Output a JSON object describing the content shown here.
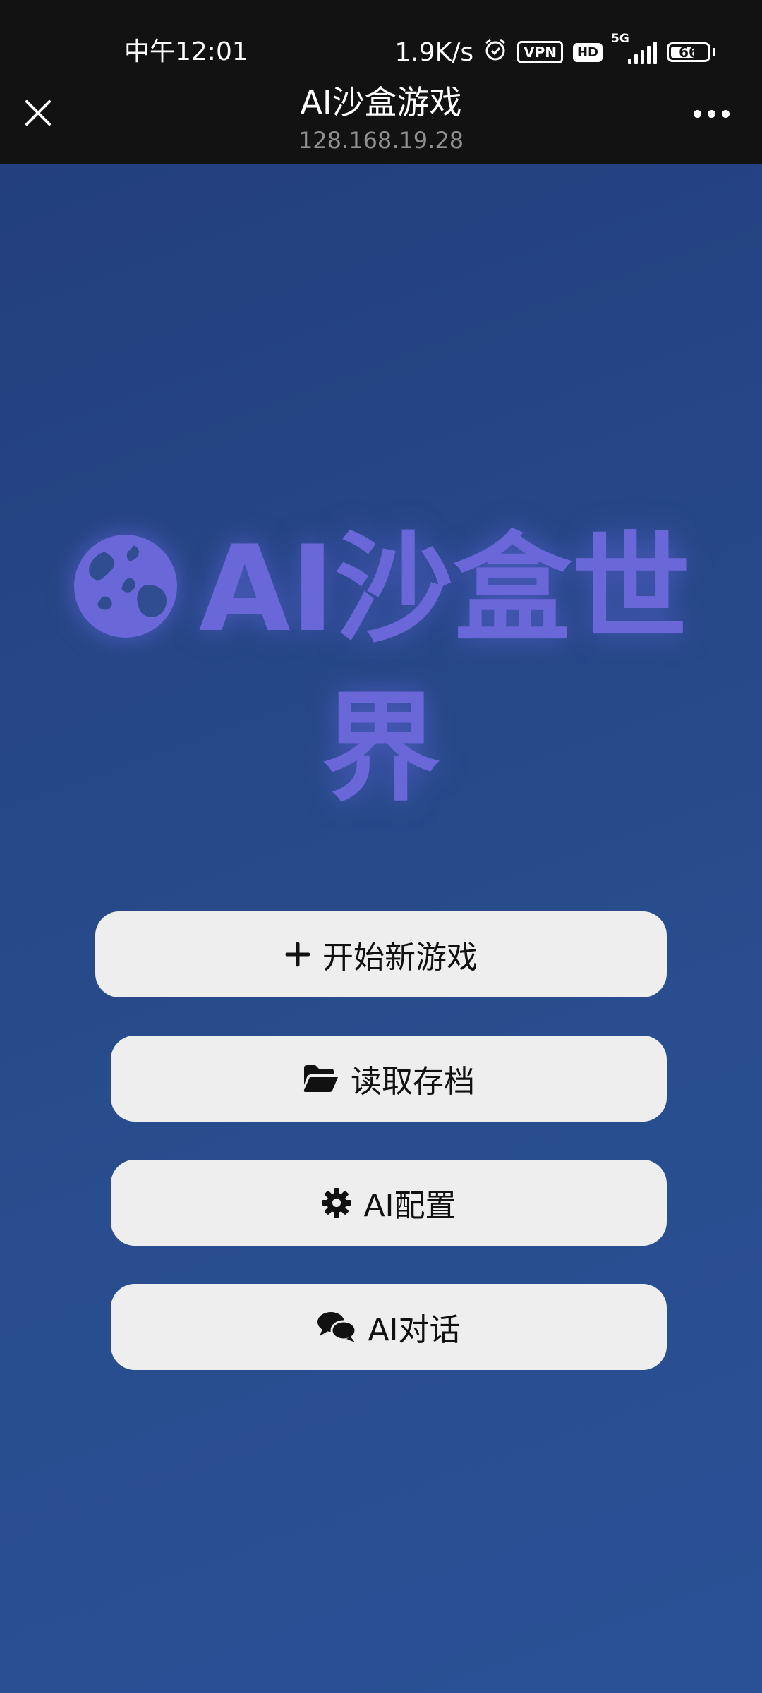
{
  "status_bar": {
    "time": "中午12:01",
    "net_speed": "1.9K/s",
    "vpn_badge": "VPN",
    "hd_badge": "HD",
    "network_type": "5G",
    "battery": "66",
    "battery_level": 0.66,
    "icons": [
      "alarm-icon",
      "vpn-icon",
      "hd-icon",
      "signal-icon",
      "battery-icon"
    ]
  },
  "nav": {
    "title": "AI沙盒游戏",
    "subtitle": "128.168.19.28",
    "close_icon": "close-icon",
    "more_icon": "more-icon"
  },
  "hero": {
    "icon": "globe-icon",
    "title": "AI沙盒世界",
    "color": "#6a68d8"
  },
  "menu": {
    "new_game": {
      "label": "开始新游戏",
      "icon": "plus-icon"
    },
    "load_save": {
      "label": "读取存档",
      "icon": "folder-open-icon"
    },
    "ai_config": {
      "label": "AI配置",
      "icon": "gear-icon"
    },
    "ai_chat": {
      "label": "AI对话",
      "icon": "chat-bubbles-icon"
    }
  },
  "colors": {
    "background_top": "#233f7d",
    "background_bottom": "#2a5096",
    "button_bg": "#eeeeee",
    "bar_bg": "#121212"
  }
}
